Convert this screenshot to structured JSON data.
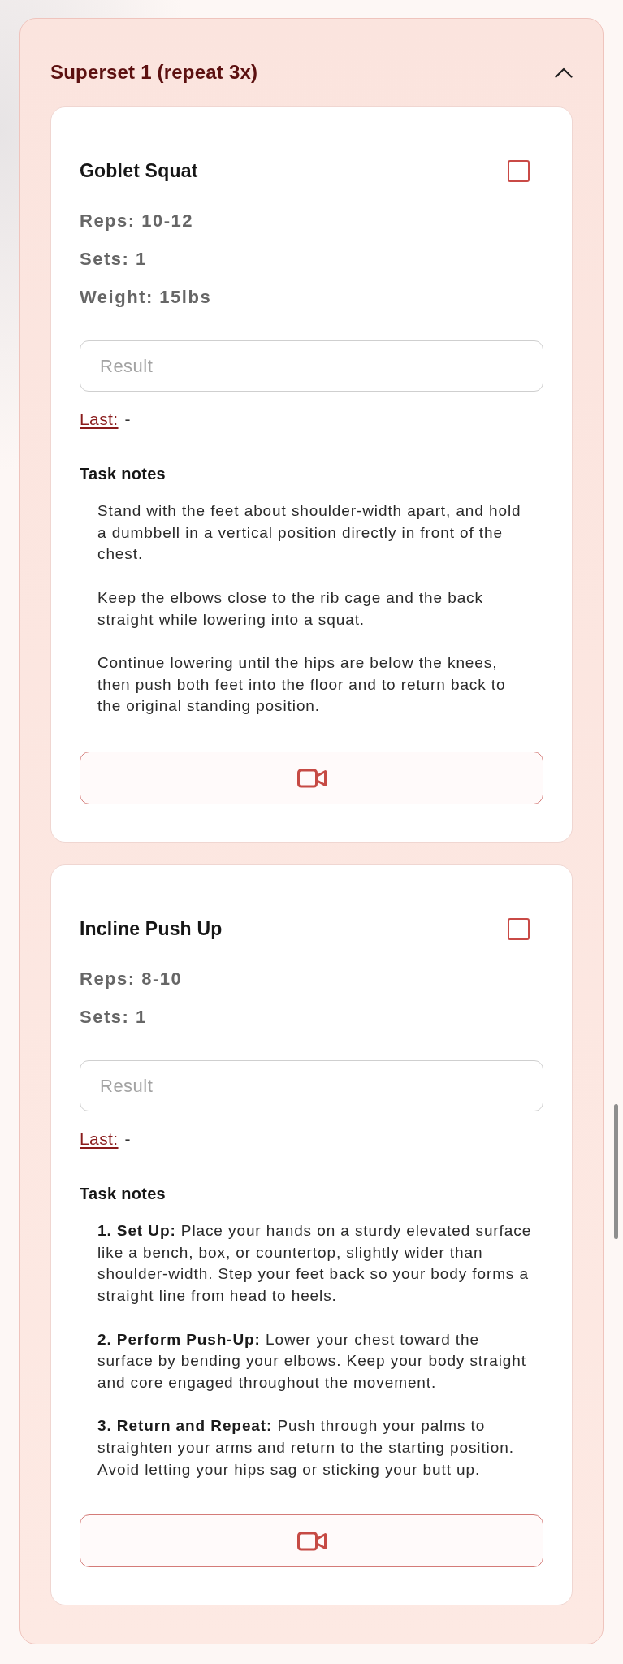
{
  "superset": {
    "title": "Superset 1 (repeat 3x)",
    "expanded": true
  },
  "exercises": [
    {
      "name": "Goblet Squat",
      "checked": false,
      "stats": [
        "Reps: 10-12",
        "Sets: 1",
        "Weight: 15lbs"
      ],
      "result": {
        "placeholder": "Result"
      },
      "last": {
        "label": "Last:",
        "value": "-"
      },
      "notes_title": "Task notes",
      "notes": [
        "Stand with the feet about shoulder-width apart, and hold a dumbbell in a vertical position directly in front of the chest.",
        "Keep the elbows close to the rib cage and the back straight while lowering into a squat.",
        "Continue lowering until the hips are below the knees, then push both feet into the floor and to return back to the original standing position."
      ]
    },
    {
      "name": "Incline Push Up",
      "checked": false,
      "stats": [
        "Reps: 8-10",
        "Sets: 1"
      ],
      "result": {
        "placeholder": "Result"
      },
      "last": {
        "label": "Last:",
        "value": "-"
      },
      "notes_title": "Task notes",
      "notes": [
        "**1. Set Up:** Place your hands on a sturdy elevated surface like a bench, box, or countertop, slightly wider than shoulder-width. Step your feet back so your body forms a straight line from head to heels.",
        "**2. Perform Push-Up:** Lower your chest toward the surface by bending your elbows. Keep your body straight and core engaged throughout the movement.",
        "**3. Return and Repeat:** Push through your palms to straighten your arms and return to the starting position. Avoid letting your hips sag or sticking your butt up."
      ]
    }
  ]
}
